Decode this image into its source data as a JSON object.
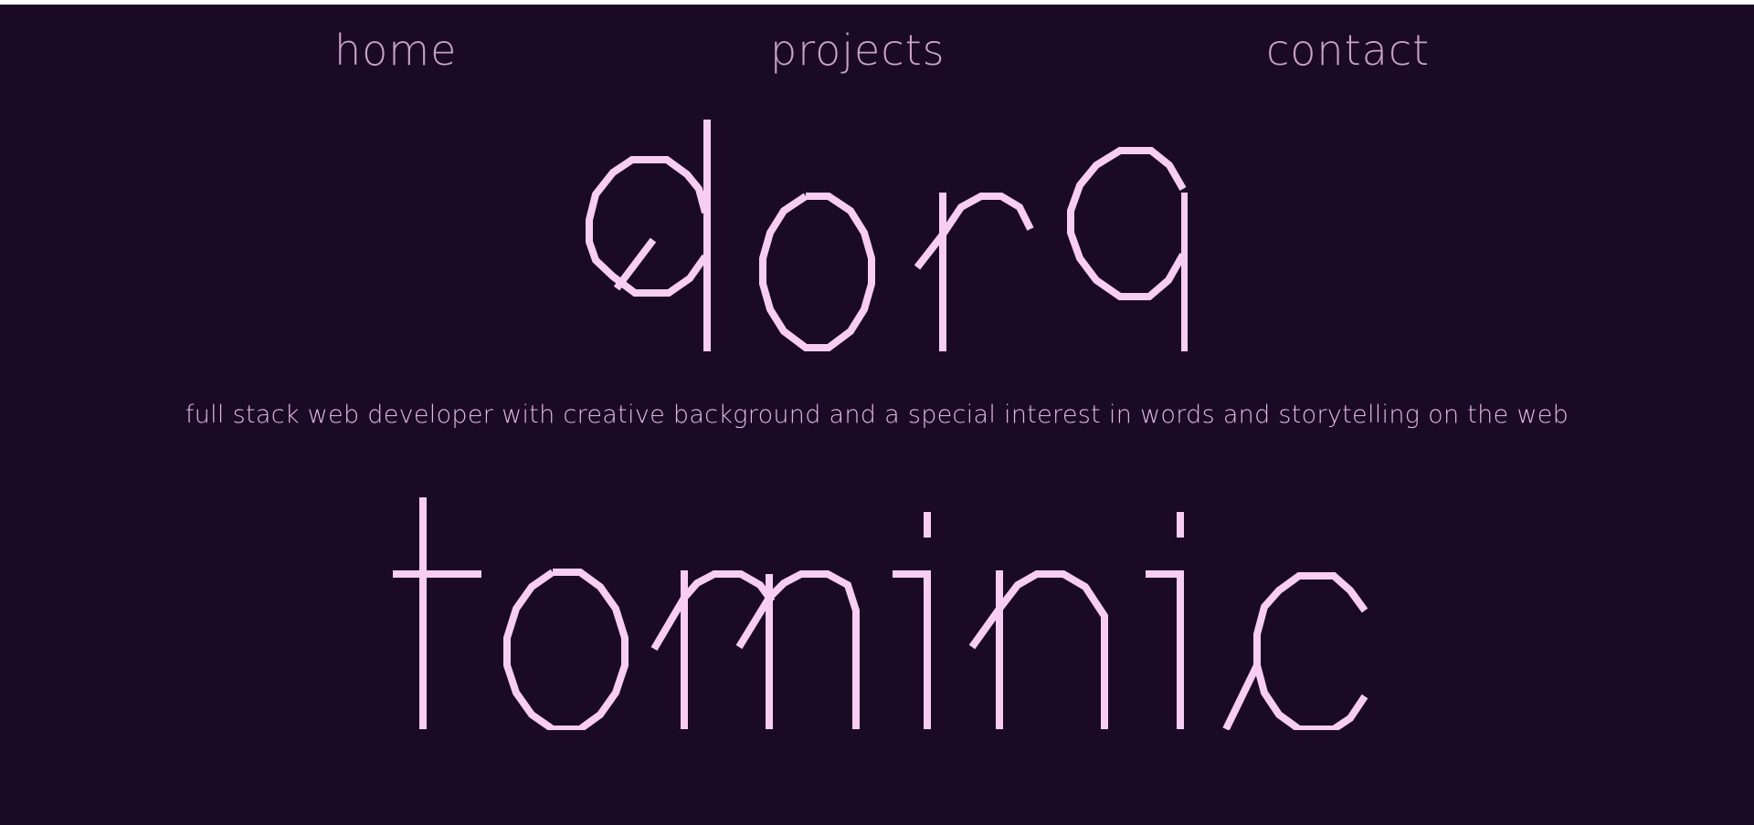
{
  "nav": {
    "items": [
      {
        "label": "home"
      },
      {
        "label": "projects"
      },
      {
        "label": "contact"
      }
    ]
  },
  "hero": {
    "first_name": "dora",
    "tagline": "full stack web developer with creative background and a special interest in words and storytelling on the web",
    "last_name": "tominic"
  },
  "colors": {
    "background": "#1a0a26",
    "name_stroke": "#f7cdf4",
    "nav_text": "#c9a2c9",
    "tagline_text": "#e5b8e6"
  }
}
